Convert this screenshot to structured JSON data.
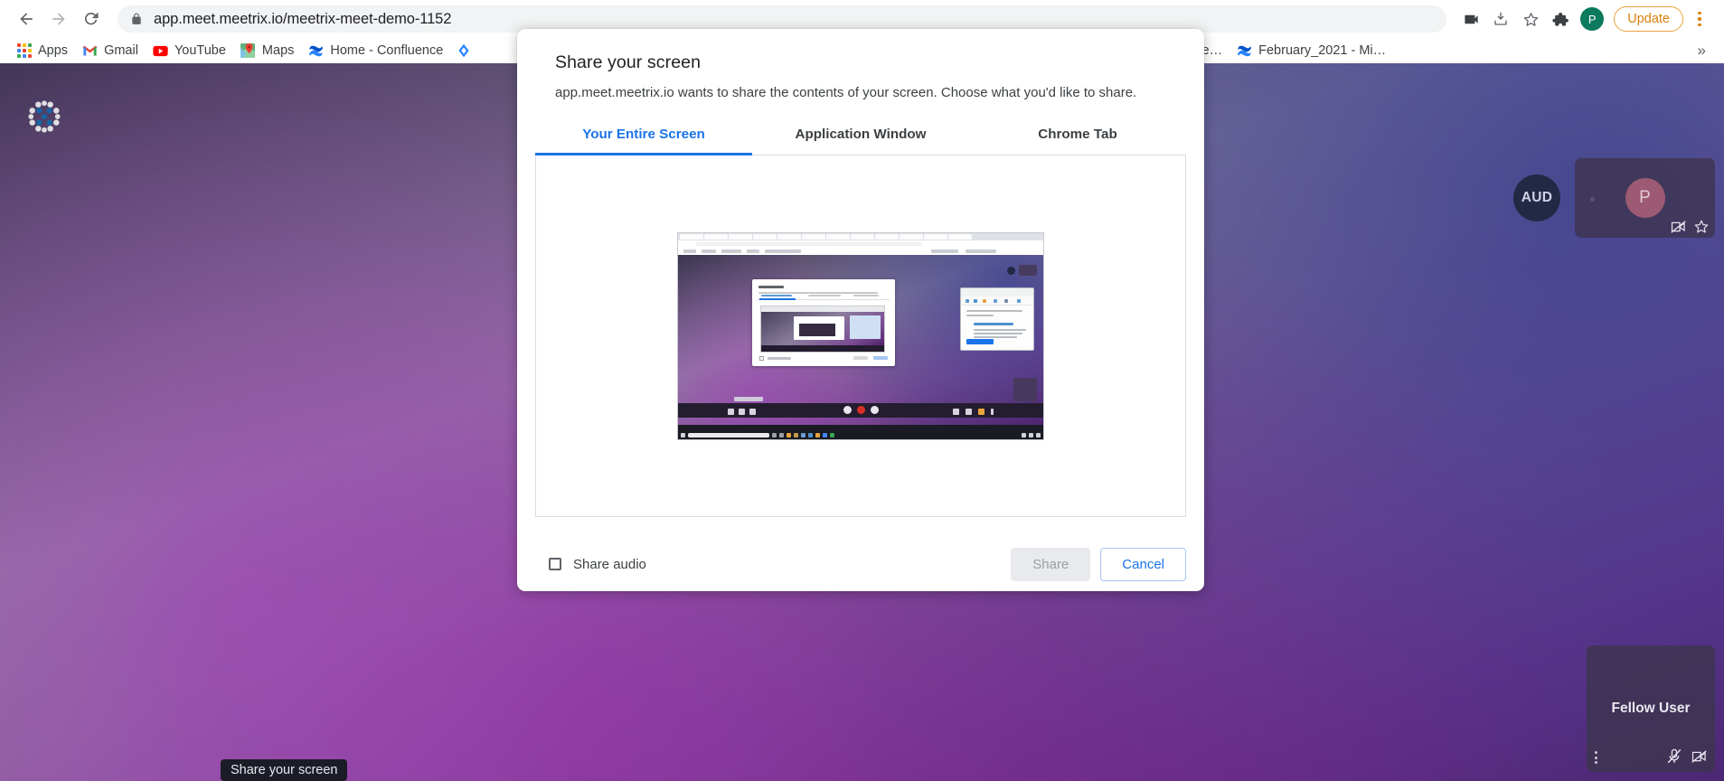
{
  "browser": {
    "back_icon": "arrow-left-icon",
    "forward_icon": "arrow-right-icon",
    "reload_icon": "reload-icon",
    "lock_icon": "lock-icon",
    "url_host": "app.meet.meetrix.io",
    "url_path": "/meetrix-meet-demo-1152",
    "url_full": "app.meet.meetrix.io/meetrix-meet-demo-1152",
    "toolbar_icons": [
      "video-camera-icon",
      "download-icon",
      "star-icon",
      "extensions-puzzle-icon"
    ],
    "profile_initial": "P",
    "update_label": "Update",
    "menu_icon": "three-dot-menu-icon",
    "bookmarks": [
      {
        "label": "Apps",
        "icon": "apps-grid-icon"
      },
      {
        "label": "Gmail",
        "icon": "gmail-icon"
      },
      {
        "label": "YouTube",
        "icon": "youtube-icon"
      },
      {
        "label": "Maps",
        "icon": "google-maps-icon"
      },
      {
        "label": "Home - Confluence",
        "icon": "confluence-icon"
      },
      {
        "label": "",
        "icon": "jira-icon"
      },
      {
        "label": "Home – prod.scree…",
        "icon": "slack-icon"
      },
      {
        "label": "February_2021 - Mi…",
        "icon": "confluence-icon"
      }
    ],
    "bookmarks_overflow": "»"
  },
  "dialog": {
    "title": "Share your screen",
    "subtitle": "app.meet.meetrix.io wants to share the contents of your screen. Choose what you'd like to share.",
    "tabs": [
      {
        "label": "Your Entire Screen",
        "active": true
      },
      {
        "label": "Application Window",
        "active": false
      },
      {
        "label": "Chrome Tab",
        "active": false
      }
    ],
    "preview_name": "entire-screen-thumbnail",
    "share_audio_label": "Share audio",
    "share_audio_checked": false,
    "share_label": "Share",
    "share_enabled": false,
    "cancel_label": "Cancel",
    "accent_color": "#1a73e8"
  },
  "meeting": {
    "logo_name": "meetrix-logo",
    "tooltip": "Share your screen",
    "participants": [
      {
        "name": "AUD",
        "type": "audio-avatar"
      },
      {
        "name": "P",
        "type": "tile",
        "camera_off": true,
        "pinned": false
      },
      {
        "name": "Fellow User",
        "type": "tile",
        "camera_off": true,
        "mic_off": true
      }
    ]
  }
}
